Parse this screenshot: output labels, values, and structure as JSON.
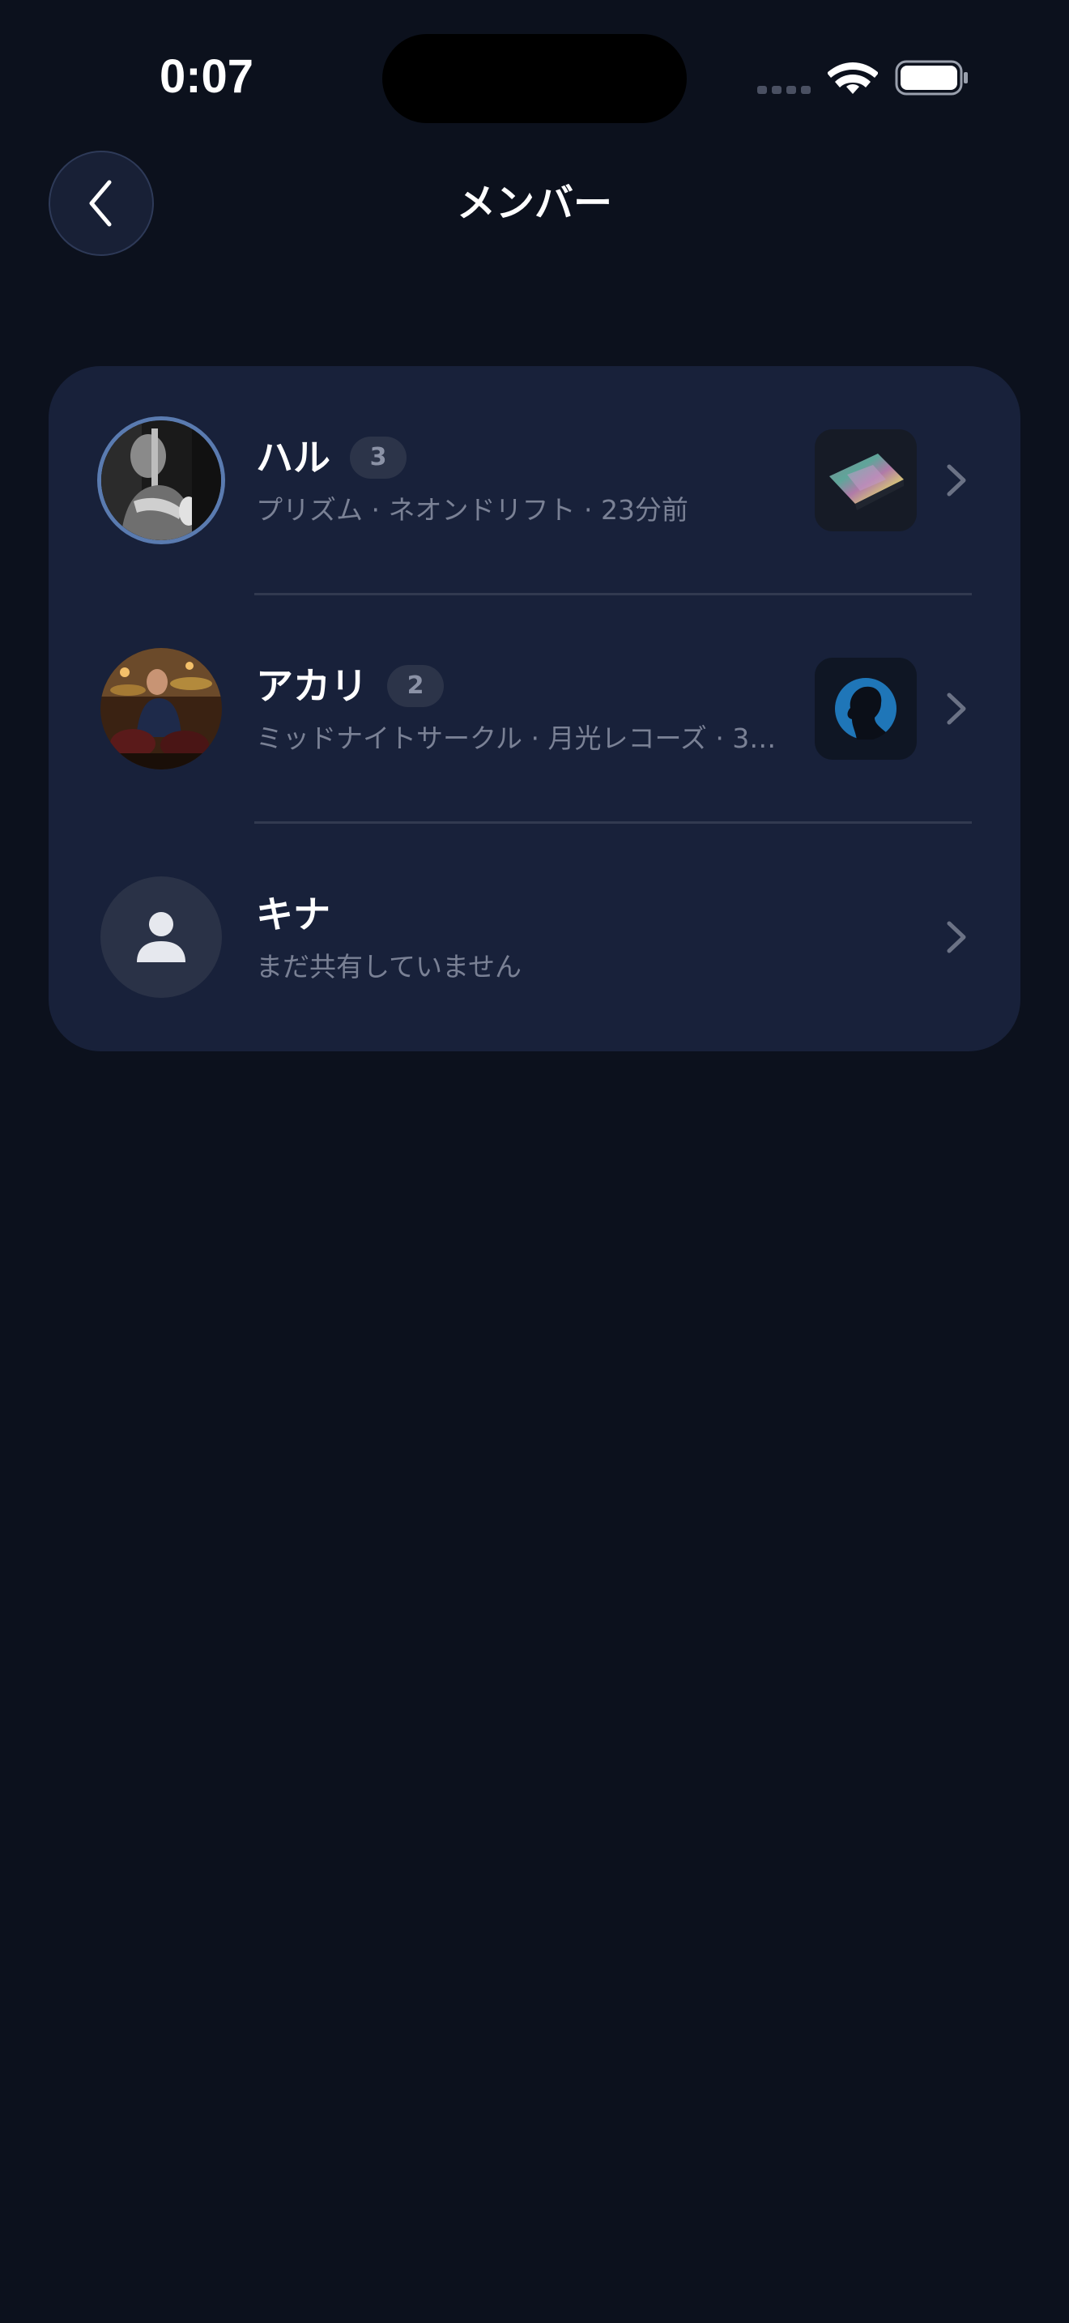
{
  "status_bar": {
    "time": "0:07"
  },
  "header": {
    "back_icon": "chevron-left-icon",
    "title": "メンバー"
  },
  "members": [
    {
      "name": "ハル",
      "count": "3",
      "subtitle": "プリズム · ネオンドリフト · 23分前",
      "avatar": "photo",
      "thumbnail": "holographic-cd"
    },
    {
      "name": "アカリ",
      "count": "2",
      "subtitle": "ミッドナイトサークル · 月光レコーズ · 3…",
      "avatar": "photo",
      "thumbnail": "silhouette-profile"
    },
    {
      "name": "キナ",
      "subtitle": "まだ共有していません",
      "avatar": "person-icon"
    }
  ],
  "colors": {
    "background": "#0c111d",
    "card": "#18213a",
    "secondary_text": "#7a8195",
    "accent_ring": "#5a7bb0"
  }
}
